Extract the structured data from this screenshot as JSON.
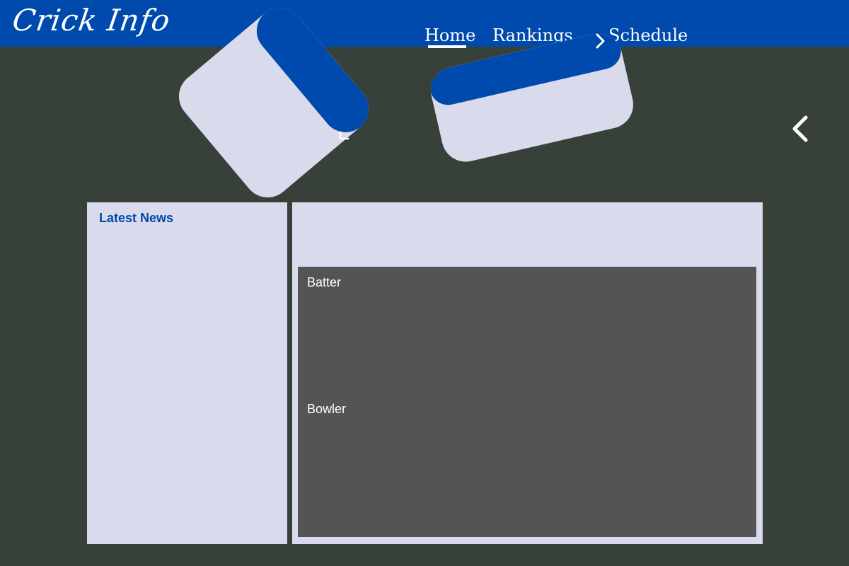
{
  "app": {
    "logo": "Crick Info"
  },
  "nav": {
    "items": [
      "Home",
      "Rankings",
      "Schedule"
    ]
  },
  "sidebar": {
    "title": "Latest News"
  },
  "scoreboard": {
    "batter_label": "Batter",
    "bowler_label": "Bowler"
  },
  "colors": {
    "brand_blue": "#004aad",
    "background": "#374139",
    "panel": "#d9dbec",
    "score_box": "#545454"
  },
  "icons": [
    "chevron-down-icon",
    "chevron-right-icon",
    "chevron-left-icon"
  ]
}
